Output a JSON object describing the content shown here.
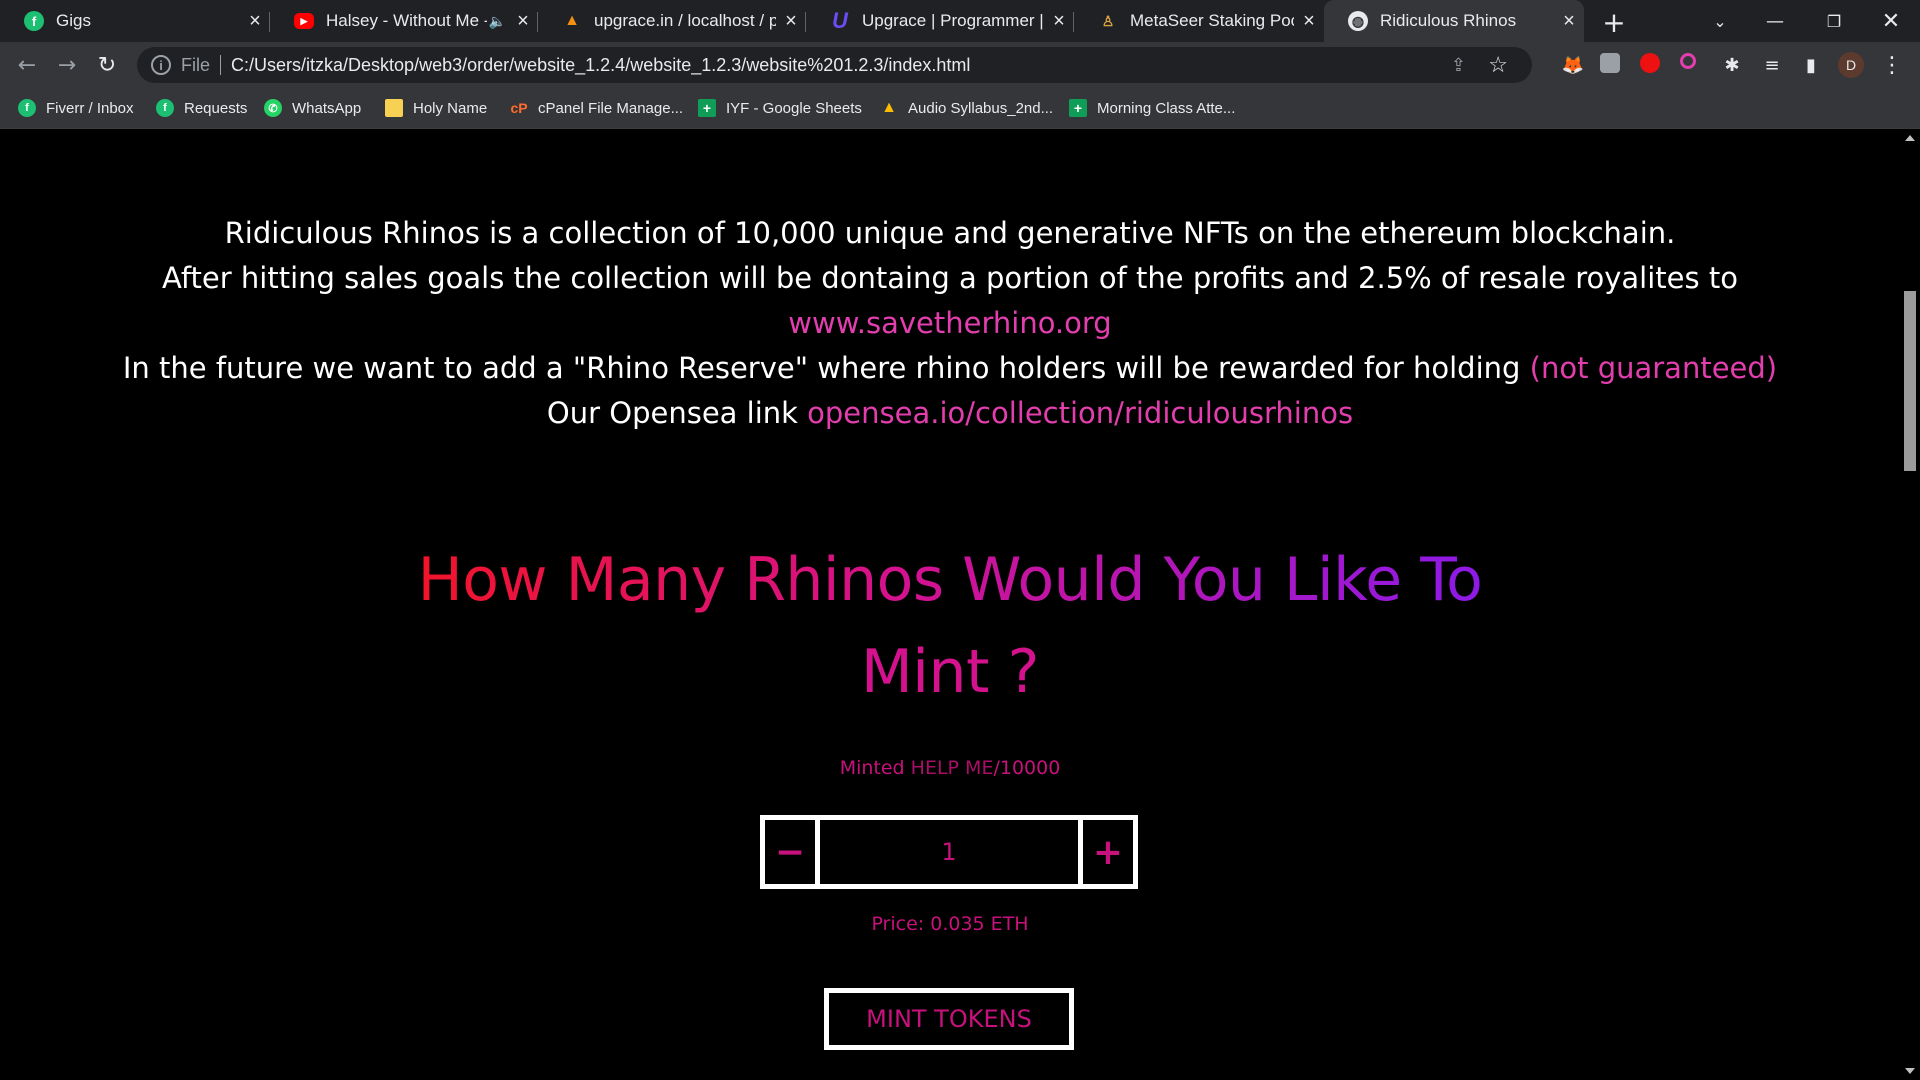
{
  "tabs": [
    {
      "title": "Gigs",
      "icon": "fiverr-icon",
      "color": "#1dbf73"
    },
    {
      "title": "Halsey - Without Me - Y",
      "icon": "youtube-icon",
      "color": "#ff0000"
    },
    {
      "title": "upgrace.in / localhost / por",
      "icon": "phpmyadmin-icon",
      "color": "#f29111"
    },
    {
      "title": "Upgrace | Programmer | Ful",
      "icon": "upgrace-icon",
      "color": "#6b4cf5"
    },
    {
      "title": "MetaSeer Staking Pool",
      "icon": "metaseer-icon",
      "color": "#d9a441"
    },
    {
      "title": "Ridiculous Rhinos",
      "icon": "globe-icon",
      "color": "#e8eaed"
    }
  ],
  "address": {
    "scheme": "File",
    "url": "C:/Users/itzka/Desktop/web3/order/website_1.2.4/website_1.2.3/website%201.2.3/index.html"
  },
  "profile_initial": "D",
  "bookmarks": [
    {
      "label": "Fiverr / Inbox",
      "color": "#1dbf73"
    },
    {
      "label": "Requests",
      "color": "#1dbf73"
    },
    {
      "label": "WhatsApp",
      "color": "#25d366"
    },
    {
      "label": "Holy Name",
      "color": "#f7d154"
    },
    {
      "label": "cPanel File Manage...",
      "color": "#ff6c2c"
    },
    {
      "label": "IYF - Google Sheets",
      "color": "#0f9d58"
    },
    {
      "label": "Audio Syllabus_2nd...",
      "color": "#fbbc04"
    },
    {
      "label": "Morning Class Atte...",
      "color": "#0f9d58"
    }
  ],
  "about": {
    "line1": "Ridiculous Rhinos is a collection of 10,000 unique and generative NFTs on the ethereum blockchain.",
    "line2": "After hitting sales goals the collection will be dontaing a portion of the profits and 2.5% of resale royalites to",
    "line3_link": "www.savetherhino.org",
    "line4": "In the future we want to add a \"Rhino Reserve\" where rhino holders will be rewarded for holding",
    "line4_note": "(not guaranteed)",
    "line5": "Our Opensea link",
    "line5_link": "opensea.io/collection/ridiculousrhinos"
  },
  "mint": {
    "heading_line1": "How Many Rhinos Would You Like To",
    "heading_line2": "Mint ?",
    "minted_label": "Minted",
    "minted_value": "HELP ME",
    "max_supply": "/10000",
    "minus": "−",
    "plus": "+",
    "quantity": "1",
    "price": "Price: 0.035 ETH",
    "button": "MINT TOKENS"
  }
}
